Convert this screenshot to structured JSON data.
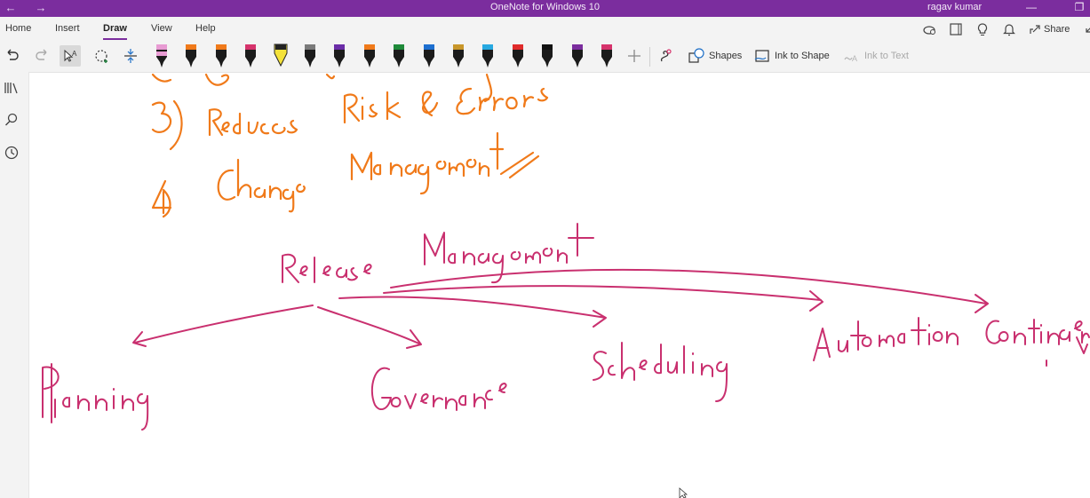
{
  "window": {
    "title": "OneNote for Windows 10",
    "user": "ragav kumar"
  },
  "menu": {
    "tabs": [
      "Home",
      "Insert",
      "Draw",
      "View",
      "Help"
    ],
    "active_tab": "Draw",
    "share_label": "Share"
  },
  "toolbar": {
    "pens": [
      {
        "color": "#e89bd3",
        "kind": "pen"
      },
      {
        "color": "#f07a1a",
        "kind": "pen"
      },
      {
        "color": "#f07a1a",
        "kind": "pen"
      },
      {
        "color": "#d6336c",
        "kind": "pen"
      },
      {
        "color": "#f4e23a",
        "kind": "highlighter"
      },
      {
        "color": "#7a7a7a",
        "kind": "pen"
      },
      {
        "color": "#6b2da8",
        "kind": "pen"
      },
      {
        "color": "#f07a1a",
        "kind": "pen"
      },
      {
        "color": "#1f8a3a",
        "kind": "pen"
      },
      {
        "color": "#1d6fd0",
        "kind": "pen"
      },
      {
        "color": "#c8962a",
        "kind": "pen"
      },
      {
        "color": "#27a9e1",
        "kind": "pen"
      },
      {
        "color": "#e02b2b",
        "kind": "pen"
      },
      {
        "color": "#111111",
        "kind": "pen"
      },
      {
        "color": "#7b2d9e",
        "kind": "pen"
      },
      {
        "color": "#d6336c",
        "kind": "pen"
      }
    ],
    "shapes_label": "Shapes",
    "ink_to_shape_label": "Ink to Shape",
    "ink_to_text_label": "Ink to Text"
  },
  "ink_colors": {
    "orange": "#f07a1a",
    "magenta": "#c9306f"
  }
}
